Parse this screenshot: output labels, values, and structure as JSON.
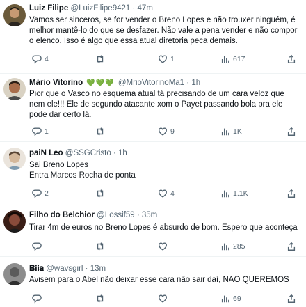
{
  "tweets": [
    {
      "name": "Luiz Filipe",
      "handle": "@LuizFilipe9421",
      "time": "47m",
      "lines": [
        "Vamos ser sinceros, se for vender o Breno Lopes e não trouxer ninguém, é",
        "melhor mantê-lo do que se desfazer. Não vale a pena vender e não compor",
        "o elenco. Isso é algo que essa atual diretoria peca demais."
      ],
      "replies": "4",
      "retweets": "",
      "likes": "1",
      "views": "617"
    },
    {
      "name": "Mário Vitorino",
      "badge": "💚💚💚",
      "handle": "@MrioVitorinoMa1",
      "time": "1h",
      "lines": [
        "Pior que o Vasco no esquema atual tá precisando de um cara veloz que",
        "nem ele!!! Ele de segundo atacante xom o Payet passando bola pra ele",
        "pode dar certo lá."
      ],
      "replies": "1",
      "retweets": "",
      "likes": "9",
      "views": "1K"
    },
    {
      "name": "paiN Leo",
      "handle": "@SSGCristo",
      "time": "1h",
      "lines": [
        "Sai Breno Lopes",
        "Entra Marcos Rocha de ponta"
      ],
      "replies": "2",
      "retweets": "",
      "likes": "4",
      "views": "1.1K"
    },
    {
      "name": "Filho do Belchior",
      "handle": "@Lossif59",
      "time": "35m",
      "lines": [
        "Tirar 4m de euros no Breno Lopes é absurdo de bom. Espero que aconteça"
      ],
      "replies": "",
      "retweets": "",
      "likes": "",
      "views": "285"
    },
    {
      "name": "𝐁𝐢𝐢𝐚",
      "handle": "@wavsgirl",
      "time": "13m",
      "lines": [
        "Avisem para o Abel não deixar esse cara não sair daí, NAO QUEREMOS"
      ],
      "replies": "",
      "retweets": "",
      "likes": "",
      "views": "69"
    }
  ],
  "separator": "·",
  "icons": [
    "reply-icon",
    "retweet-icon",
    "like-icon",
    "views-icon",
    "share-icon"
  ]
}
